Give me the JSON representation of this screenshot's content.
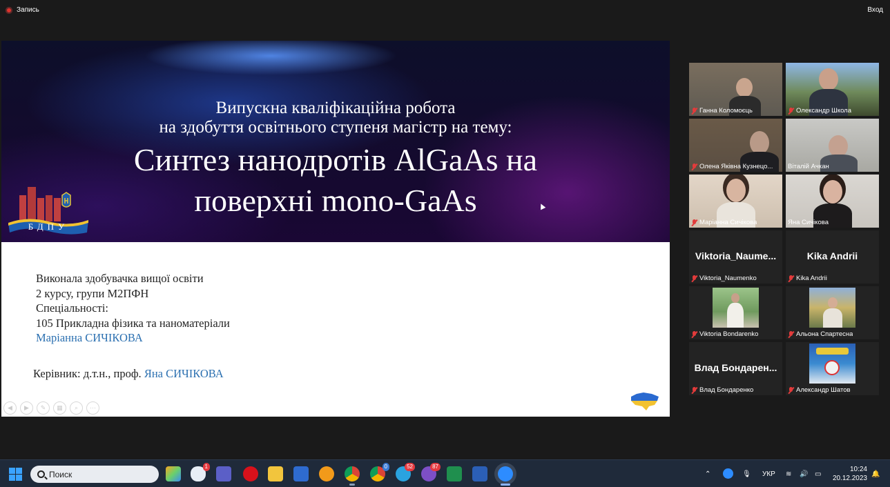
{
  "topbar": {
    "record_label": "Запись",
    "signin_label": "Вход"
  },
  "slide": {
    "title_line1": "Випускна кваліфікаційна робота",
    "title_line2": "на здобуття освітнього ступеня магістр на тему:",
    "title_line3": "Синтез нанодротів AlGaAs на",
    "title_line4": "поверхні mono-GaAs",
    "logo_text": "БДПУ",
    "info_line1": "Виконала здобувачка вищої освіти",
    "info_line2": "2 курсу, групи М2ПФН",
    "info_line3": "Спеціальності:",
    "info_line4": "105 Прикладна фізика та наноматеріали",
    "student_name": "Маріанна СИЧІКОВА",
    "supervisor_prefix": "Керівник:  д.т.н., проф.",
    "supervisor_name": "Яна СИЧІКОВА"
  },
  "participants": [
    {
      "name": "Ганна Коломоєць",
      "muted": true
    },
    {
      "name": "Олександр Школа",
      "muted": true
    },
    {
      "name": "Олена Яківна Кузнецо...",
      "muted": true
    },
    {
      "name": "Віталій Ачкан",
      "muted": false
    },
    {
      "name": "Маріанна Сичікова",
      "muted": true
    },
    {
      "name": "Яна Сичікова",
      "muted": false,
      "active_speaker": true
    },
    {
      "name": "Viktoria_Naumenko",
      "display": "Viktoria_Naume...",
      "muted": true
    },
    {
      "name": "Kika Andrii",
      "display": "Kika Andrii",
      "muted": true
    },
    {
      "name": "Viktoria Bondarenko",
      "muted": true
    },
    {
      "name": "Альона Спартесна",
      "muted": true
    },
    {
      "name": "Влад Бондаренко",
      "display": "Влад  Бондарен...",
      "muted": true
    },
    {
      "name": "Александр Шатов",
      "muted": true
    }
  ],
  "taskbar": {
    "search_placeholder": "Поиск",
    "badges": {
      "weather": "1",
      "chrome2": "0",
      "telegram": "52",
      "viber": "87"
    },
    "language": "УКР",
    "time": "10:24",
    "date": "20.12.2023"
  },
  "colors": {
    "active_speaker": "#d8e63a",
    "link_blue": "#2a6fb0",
    "taskbar": "#1f2a3a",
    "mic_muted": "#e23b3b"
  }
}
